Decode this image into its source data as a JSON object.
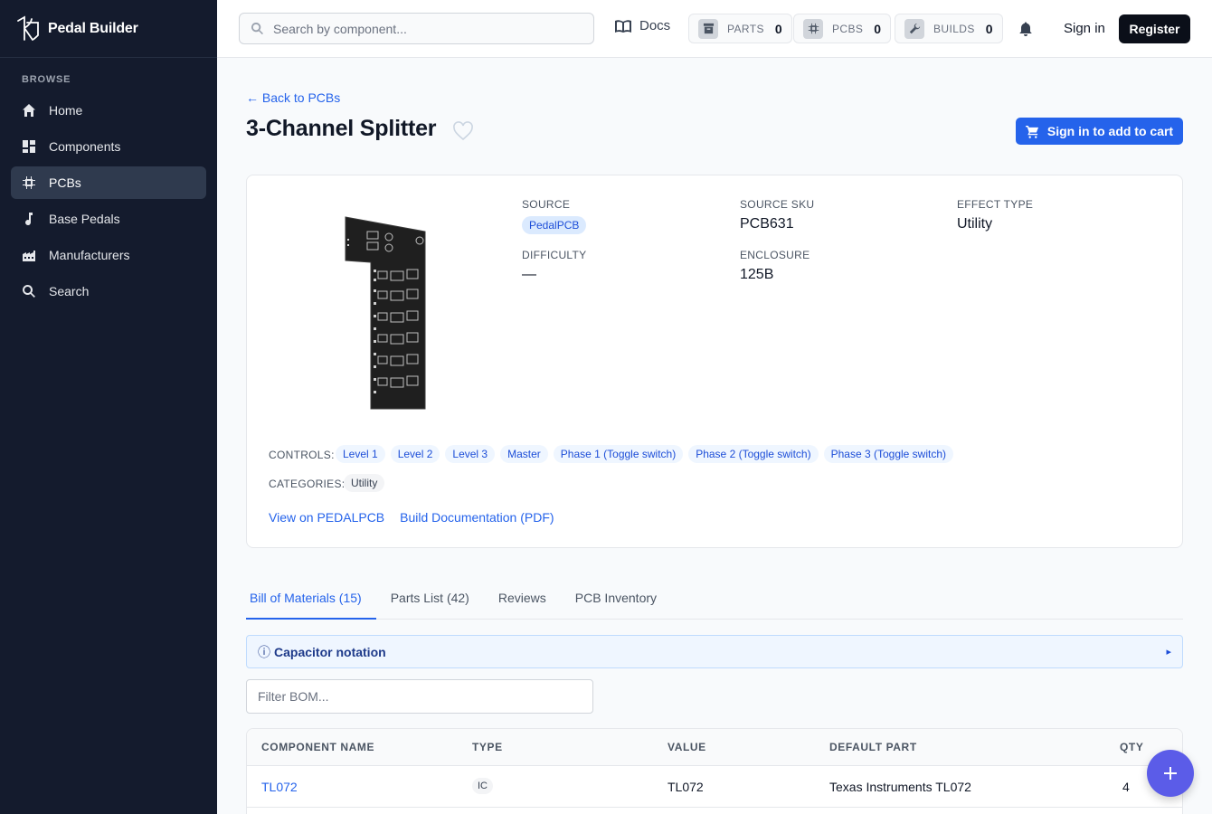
{
  "brand": {
    "name": "Pedal Builder"
  },
  "sidebar": {
    "heading": "BROWSE",
    "items": [
      {
        "label": "Home",
        "icon": "home-icon"
      },
      {
        "label": "Components",
        "icon": "grid-icon"
      },
      {
        "label": "PCBs",
        "icon": "chip-icon",
        "active": true
      },
      {
        "label": "Base Pedals",
        "icon": "music-note-icon"
      },
      {
        "label": "Manufacturers",
        "icon": "factory-icon"
      },
      {
        "label": "Search",
        "icon": "search-icon"
      }
    ]
  },
  "topbar": {
    "search_placeholder": "Search by component...",
    "docs_label": "Docs",
    "counters": [
      {
        "label": "PARTS",
        "value": "0",
        "icon": "archive-icon"
      },
      {
        "label": "PCBS",
        "value": "0",
        "icon": "chip-icon"
      },
      {
        "label": "BUILDS",
        "value": "0",
        "icon": "wrench-icon"
      }
    ],
    "signin_label": "Sign in",
    "register_label": "Register"
  },
  "page": {
    "back_label": "← Back to PCBs",
    "title": "3-Channel Splitter",
    "cart_label": "Sign in to add to cart"
  },
  "details": {
    "source_label": "SOURCE",
    "source_value": "PedalPCB",
    "sku_label": "SOURCE SKU",
    "sku_value": "PCB631",
    "effect_label": "EFFECT TYPE",
    "effect_value": "Utility",
    "difficulty_label": "DIFFICULTY",
    "difficulty_value": "—",
    "enclosure_label": "ENCLOSURE",
    "enclosure_value": "125B",
    "controls_label": "CONTROLS:",
    "controls": [
      "Level 1",
      "Level 2",
      "Level 3",
      "Master",
      "Phase 1 (Toggle switch)",
      "Phase 2 (Toggle switch)",
      "Phase 3 (Toggle switch)"
    ],
    "categories_label": "CATEGORIES:",
    "categories": [
      "Utility"
    ],
    "link_vendor": "View on PEDALPCB",
    "link_docs": "Build Documentation (PDF)"
  },
  "tabs": [
    {
      "label": "Bill of Materials (15)",
      "active": true
    },
    {
      "label": "Parts List (42)"
    },
    {
      "label": "Reviews"
    },
    {
      "label": "PCB Inventory"
    }
  ],
  "notation": {
    "info_glyph": "ⓘ",
    "label": "Capacitor notation",
    "arrow": "▸"
  },
  "bom": {
    "filter_placeholder": "Filter BOM...",
    "columns": [
      "COMPONENT NAME",
      "TYPE",
      "VALUE",
      "DEFAULT PART",
      "QTY"
    ],
    "rows": [
      {
        "name": "TL072",
        "type": "IC",
        "value": "TL072",
        "default_part": "Texas Instruments TL072",
        "qty": "4"
      }
    ]
  },
  "colors": {
    "accent": "#2563eb",
    "sidebar_bg": "#141b2d",
    "fab": "#5b5ce8"
  }
}
